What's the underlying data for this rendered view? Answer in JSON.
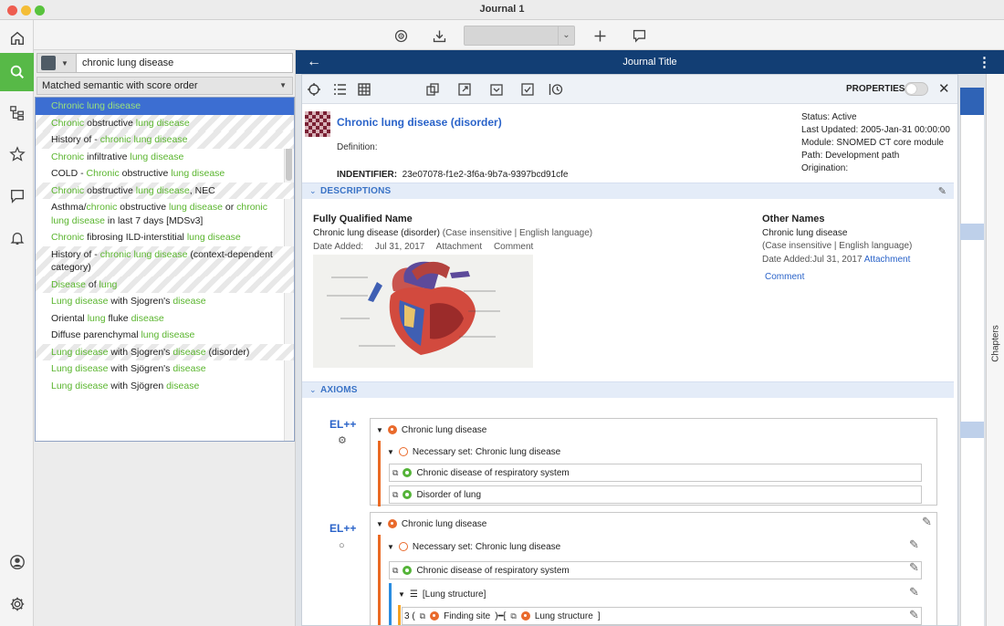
{
  "window": {
    "title": "Journal 1"
  },
  "rail": {
    "items": [
      "home-icon",
      "search-icon",
      "hierarchy-icon",
      "star-icon",
      "chat-icon",
      "bell-icon",
      "user-icon",
      "gear-icon"
    ]
  },
  "toolbar": {
    "icons": [
      "target-icon",
      "download-icon",
      "plus-icon",
      "comment-icon"
    ],
    "select_value": ""
  },
  "search": {
    "query": "chronic lung disease",
    "mode": "Matched semantic with score order",
    "results": [
      [
        {
          "t": "Chronic lung disease",
          "h": true
        }
      ],
      [
        {
          "t": "Chronic",
          "h": true
        },
        {
          "t": " obstructive "
        },
        {
          "t": "lung disease",
          "h": true
        }
      ],
      [
        {
          "t": "History of - "
        },
        {
          "t": "chronic lung disease",
          "h": true
        }
      ],
      [
        {
          "t": "Chronic",
          "h": true
        },
        {
          "t": " infiltrative "
        },
        {
          "t": "lung disease",
          "h": true
        }
      ],
      [
        {
          "t": "COLD - "
        },
        {
          "t": "Chronic",
          "h": true
        },
        {
          "t": " obstructive "
        },
        {
          "t": "lung disease",
          "h": true
        }
      ],
      [
        {
          "t": "Chronic",
          "h": true
        },
        {
          "t": " obstructive "
        },
        {
          "t": "lung disease",
          "h": true
        },
        {
          "t": ", NEC"
        }
      ],
      [
        {
          "t": "Asthma/"
        },
        {
          "t": "chronic",
          "h": true
        },
        {
          "t": " obstructive "
        },
        {
          "t": "lung disease",
          "h": true
        },
        {
          "t": " or "
        },
        {
          "t": "chronic lung disease",
          "h": true
        },
        {
          "t": " in last 7 days [MDSv3]"
        }
      ],
      [
        {
          "t": "Chronic",
          "h": true
        },
        {
          "t": " fibrosing ILD-interstitial "
        },
        {
          "t": "lung disease",
          "h": true
        }
      ],
      [
        {
          "t": "History of - "
        },
        {
          "t": "chronic lung disease",
          "h": true
        },
        {
          "t": " (context-dependent category)"
        }
      ],
      [
        {
          "t": "Disease",
          "h": true
        },
        {
          "t": " of "
        },
        {
          "t": "lung",
          "h": true
        }
      ],
      [
        {
          "t": "Lung disease",
          "h": true
        },
        {
          "t": " with Sjogren's "
        },
        {
          "t": "disease",
          "h": true
        }
      ],
      [
        {
          "t": "Oriental "
        },
        {
          "t": "lung",
          "h": true
        },
        {
          "t": " fluke "
        },
        {
          "t": "disease",
          "h": true
        }
      ],
      [
        {
          "t": "Diffuse parenchymal "
        },
        {
          "t": "lung disease",
          "h": true
        }
      ],
      [
        {
          "t": "Lung disease",
          "h": true
        },
        {
          "t": " with Sjogren's "
        },
        {
          "t": "disease",
          "h": true
        },
        {
          "t": " (disorder)"
        }
      ],
      [
        {
          "t": "Lung disease",
          "h": true
        },
        {
          "t": " with Sjögren's "
        },
        {
          "t": "disease",
          "h": true
        }
      ],
      [
        {
          "t": "Lung disease",
          "h": true
        },
        {
          "t": " with Sjögren "
        },
        {
          "t": "disease",
          "h": true
        }
      ]
    ]
  },
  "journal": {
    "title": "Journal Title",
    "chapters_label": "Chapters"
  },
  "card": {
    "properties_label": "PROPERTIES",
    "concept_title": "Chronic lung disease (disorder)",
    "definition_label": "Definition:",
    "identifier_label": "INDENTIFIER:",
    "identifier_value": "23e07078-f1e2-3f6a-9b7a-9397bcd91cfe",
    "status": "Status: Active",
    "last_updated": "Last Updated: 2005-Jan-31 00:00:00",
    "module": "Module: SNOMED CT core module",
    "path": "Path: Development path",
    "origination": "Origination:",
    "descriptions_label": "DESCRIPTIONS",
    "fqn_heading": "Fully Qualified Name",
    "fqn_term": "Chronic lung disease (disorder)",
    "fqn_case": "(Case insensitive | English language)",
    "fqn_date_added": "Date Added:",
    "fqn_date": "Jul 31, 2017",
    "fqn_attachment": "Attachment",
    "fqn_comment": "Comment",
    "other_names_heading": "Other Names",
    "other_term": "Chronic lung disease",
    "other_case": "(Case insensitive | English language)",
    "other_date": "Date Added:Jul 31, 2017",
    "other_attachment": "Attachment",
    "other_comment": "Comment",
    "axioms_label": "AXIOMS",
    "axiom1": {
      "el": "EL++",
      "root": "Chronic lung disease",
      "set": "Necessary set: Chronic lung disease",
      "parents": [
        "Chronic disease of respiratory system",
        "Disorder of lung"
      ]
    },
    "axiom2": {
      "el": "EL++",
      "root": "Chronic lung disease",
      "set": "Necessary set: Chronic lung disease",
      "parent": "Chronic disease of respiratory system",
      "group": "[Lung structure]",
      "rel_prefix": "3 (",
      "rel_attr": "Finding site",
      "rel_mid": ")━[",
      "rel_target": "Lung structure",
      "rel_suffix": "]"
    }
  }
}
